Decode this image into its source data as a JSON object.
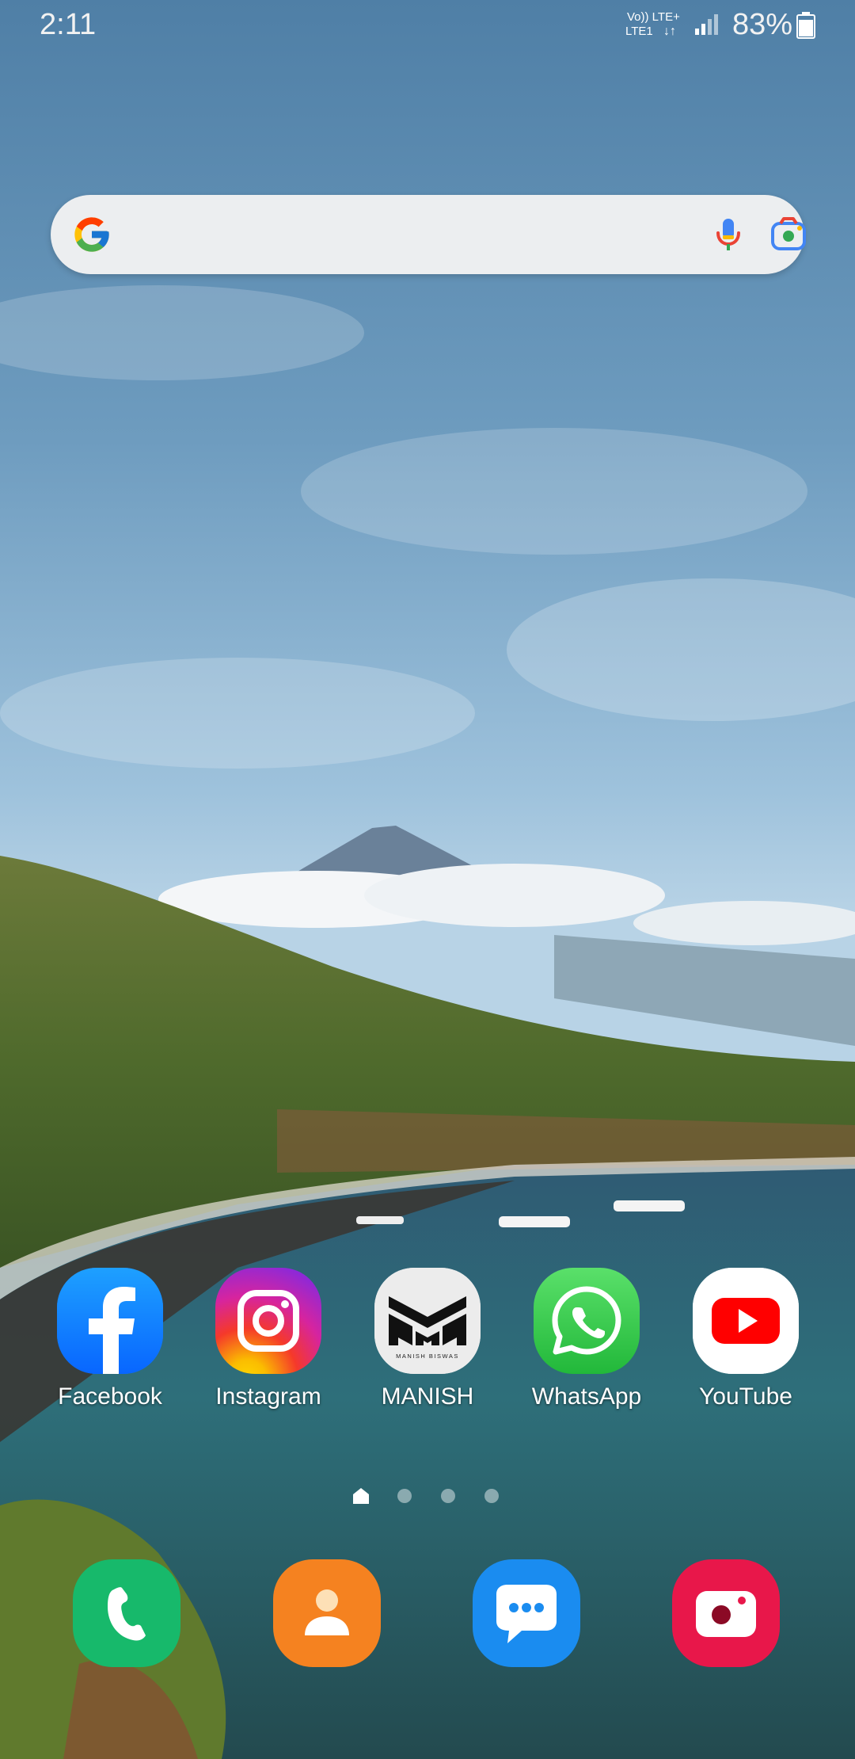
{
  "status_bar": {
    "time": "2:11",
    "network_top": "Vo)) LTE+",
    "network_bottom": "LTE1",
    "battery_percent": "83%",
    "battery_level": 0.83
  },
  "search_bar": {
    "logo": "google-g-icon",
    "mic_icon": "microphone-icon",
    "lens_icon": "google-lens-icon"
  },
  "apps": [
    {
      "label": "Facebook",
      "icon": "facebook-icon",
      "color": "#1877F2"
    },
    {
      "label": "Instagram",
      "icon": "instagram-icon",
      "color": "#DD2A7B"
    },
    {
      "label": "MANISH",
      "icon": "manish-biswas-logo-icon",
      "icon_text": "MANISH BISWAS",
      "color": "#ECECEC"
    },
    {
      "label": "WhatsApp",
      "icon": "whatsapp-icon",
      "color": "#25D366"
    },
    {
      "label": "YouTube",
      "icon": "youtube-icon",
      "color": "#FF0000"
    }
  ],
  "page_indicator": {
    "pages": 4,
    "current": 1,
    "home_icon": "home-icon"
  },
  "dock": [
    {
      "icon": "phone-icon",
      "color": "#17B96B"
    },
    {
      "icon": "contacts-icon",
      "color": "#F58220"
    },
    {
      "icon": "messages-icon",
      "color": "#1A8CF0"
    },
    {
      "icon": "camera-icon",
      "color": "#E8174A"
    }
  ]
}
